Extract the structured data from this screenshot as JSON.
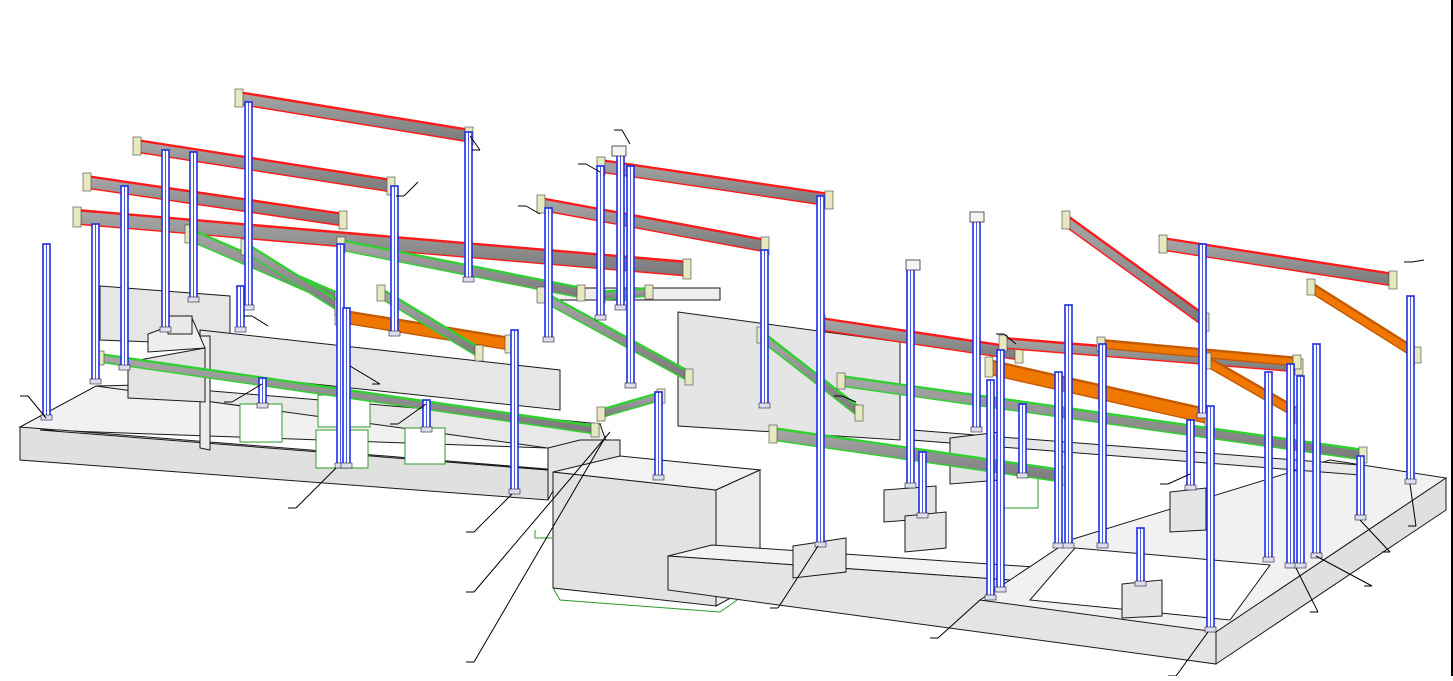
{
  "drawing": {
    "title": "",
    "colors": {
      "background": "#ffffff",
      "concrete_top": "#f2f2f2",
      "concrete_side": "#e3e3e3",
      "concrete_edge": "#1a1a1a",
      "column_steel": "#1f2ee0",
      "column_core": "#ffffff",
      "beam_web": "#8f8f8f",
      "beam_top_red": "#ff1a1a",
      "beam_green": "#2fd12f",
      "beam_orange": "#f07800",
      "plate": "#e8e8c0",
      "leader_line": "#000000",
      "foundation_outline_green": "#2a9a2a"
    },
    "element_types": [
      "concrete-foundation",
      "steel-column",
      "steel-beam-red",
      "steel-beam-green",
      "steel-beam-orange",
      "pedestal",
      "leader-line"
    ],
    "callout_labels": []
  }
}
